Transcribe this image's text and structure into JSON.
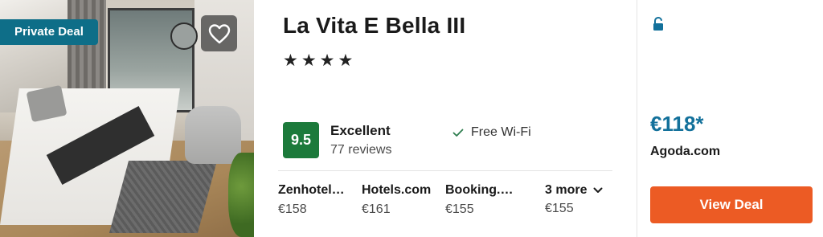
{
  "photo": {
    "badge_label": "Private Deal"
  },
  "hotel": {
    "name": "La Vita E Bella III",
    "stars": "★★★★",
    "rating_score": "9.5",
    "rating_label": "Excellent",
    "review_count": "77 reviews",
    "amenity": "Free Wi-Fi"
  },
  "providers": [
    {
      "name": "Zenhotel…",
      "price": "€158"
    },
    {
      "name": "Hotels.com",
      "price": "€161"
    },
    {
      "name": "Booking.…",
      "price": "€155"
    }
  ],
  "more": {
    "label": "3 more",
    "price": "€155"
  },
  "deal": {
    "price": "€118*",
    "site": "Agoda.com",
    "button_label": "View Deal"
  },
  "colors": {
    "badge": "#0e6e88",
    "rating": "#1c7a3b",
    "price": "#13719b",
    "cta": "#ec5b24"
  },
  "icons": [
    "heart-icon",
    "check-icon",
    "chevron-down-icon",
    "unlock-icon"
  ]
}
